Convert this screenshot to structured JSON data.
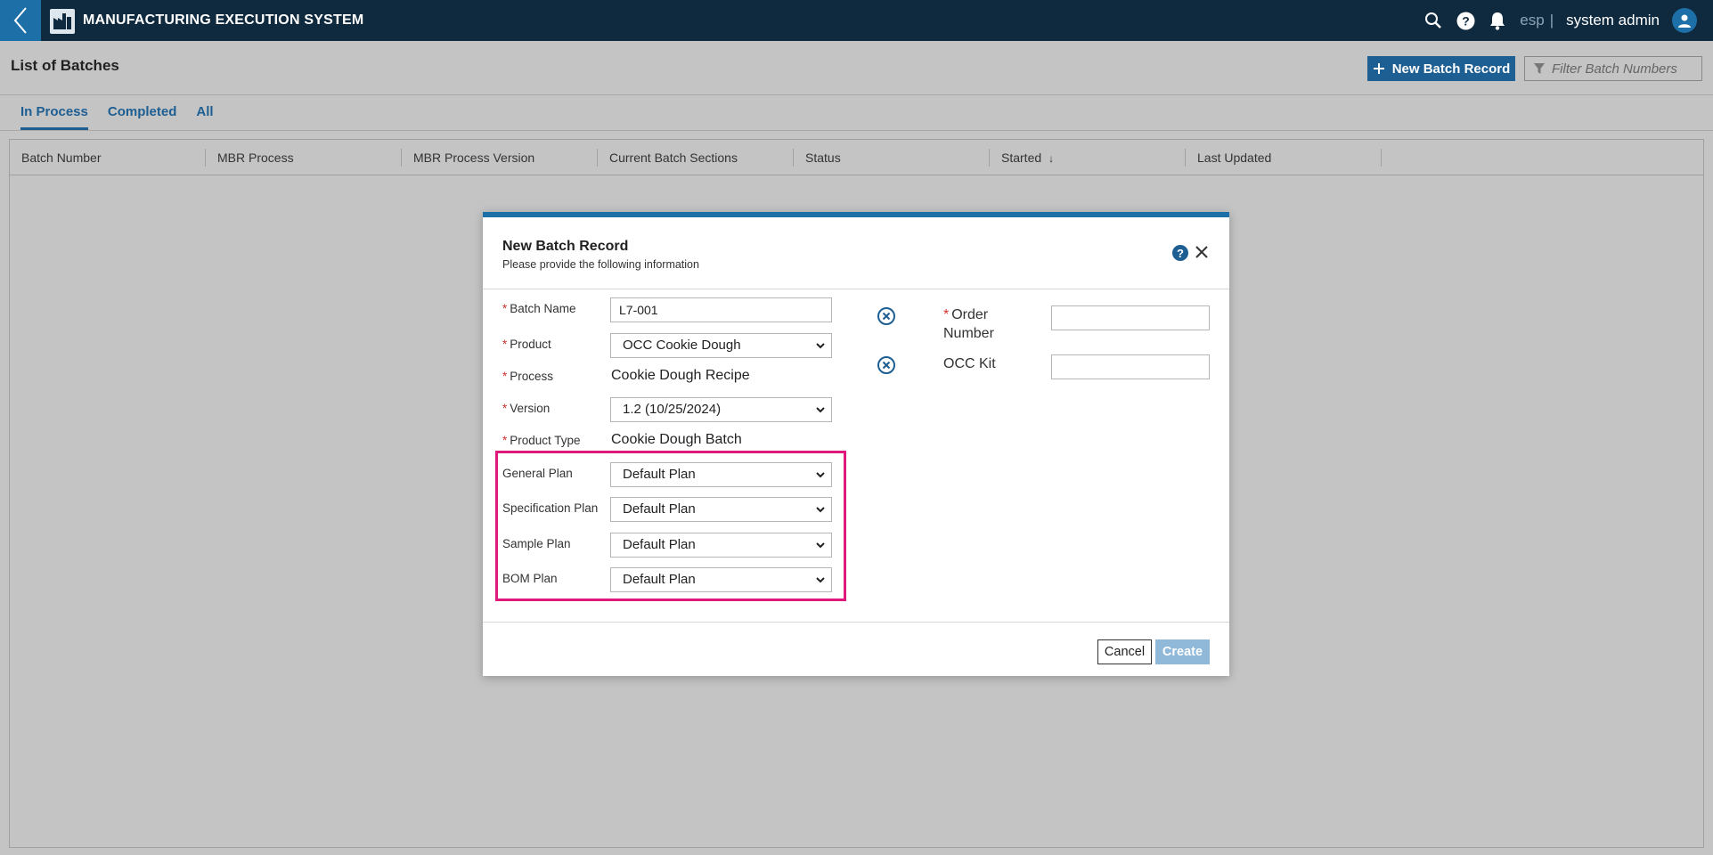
{
  "app": {
    "title": "MANUFACTURING EXECUTION SYSTEM"
  },
  "header": {
    "lang": "esp",
    "separator": "|",
    "user": "system admin"
  },
  "page": {
    "title": "List of Batches",
    "new_batch_label": "New Batch Record",
    "filter_placeholder": "Filter Batch Numbers"
  },
  "tabs": [
    {
      "label": "In Process",
      "active": true
    },
    {
      "label": "Completed",
      "active": false
    },
    {
      "label": "All",
      "active": false
    }
  ],
  "table": {
    "columns": [
      "Batch Number",
      "MBR Process",
      "MBR Process Version",
      "Current Batch Sections",
      "Status",
      "Started",
      "Last Updated"
    ],
    "rows": []
  },
  "modal": {
    "title": "New Batch Record",
    "subtitle": "Please provide the following information",
    "help_label": "?",
    "fields": {
      "batch_name": {
        "label": "Batch Name",
        "value": "L7-001"
      },
      "product": {
        "label": "Product",
        "value": "OCC Cookie Dough"
      },
      "process": {
        "label": "Process",
        "value": "Cookie Dough Recipe"
      },
      "version": {
        "label": "Version",
        "value": "1.2 (10/25/2024)"
      },
      "product_type": {
        "label": "Product Type",
        "value": "Cookie Dough Batch"
      },
      "general_plan": {
        "label": "General Plan",
        "value": "Default Plan"
      },
      "specification_plan": {
        "label": "Specification Plan",
        "value": "Default Plan"
      },
      "sample_plan": {
        "label": "Sample Plan",
        "value": "Default Plan"
      },
      "bom_plan": {
        "label": "BOM Plan",
        "value": "Default Plan"
      }
    },
    "right_fields": {
      "order_number": {
        "label_line1": "Order",
        "label_line2": "Number",
        "value": ""
      },
      "occ_kit": {
        "label": "OCC Kit",
        "value": ""
      }
    },
    "required_mark": "*",
    "cancel_label": "Cancel",
    "create_label": "Create"
  },
  "colors": {
    "topbar": "#0f2a3f",
    "accent": "#1d5e93",
    "highlight": "#e01a7d",
    "required": "#d0312d"
  }
}
